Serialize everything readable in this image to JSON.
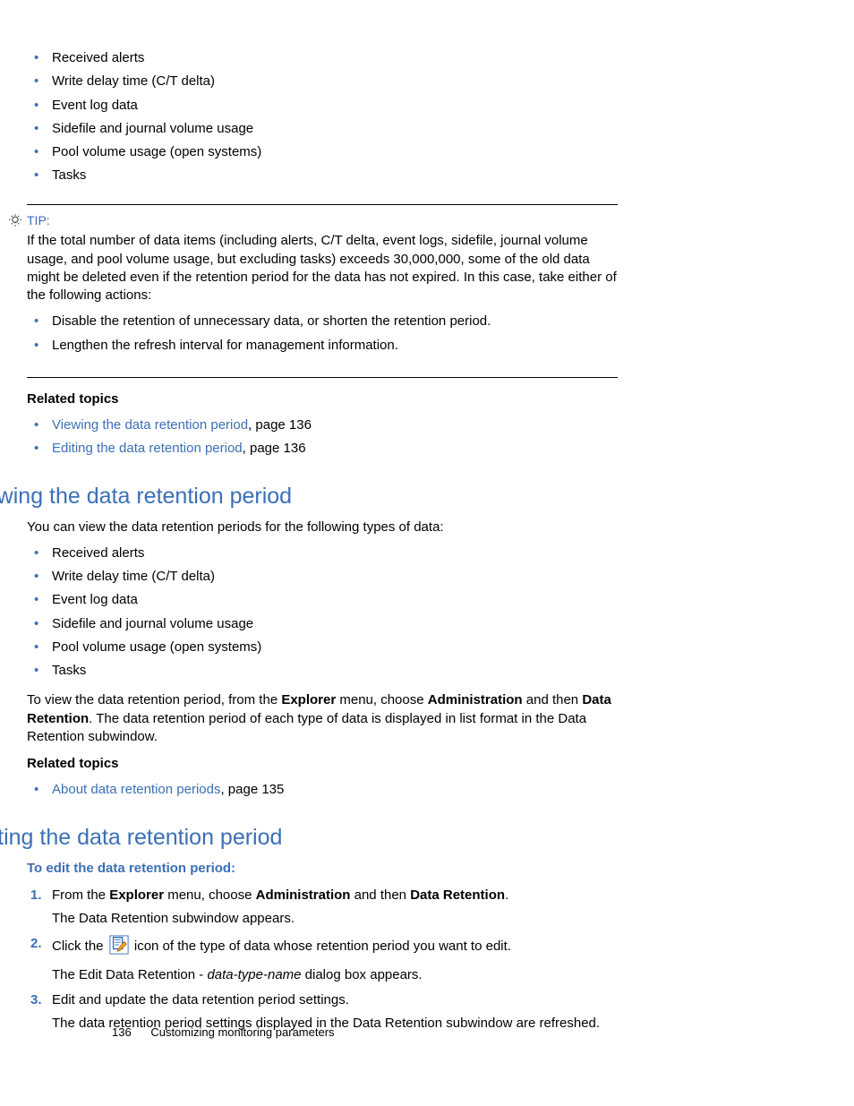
{
  "topList": [
    "Received alerts",
    "Write delay time (C/T delta)",
    "Event log data",
    "Sidefile and journal volume usage",
    "Pool volume usage (open systems)",
    "Tasks"
  ],
  "tip": {
    "label": "TIP:",
    "body": "If the total number of data items (including alerts, C/T delta, event logs, sidefile, journal volume usage, and pool volume usage, but excluding tasks) exceeds 30,000,000, some of the old data might be deleted even if the retention period for the data has not expired. In this case, take either of the following actions:",
    "items": [
      "Disable the retention of unnecessary data, or shorten the retention period.",
      "Lengthen the refresh interval for management information."
    ]
  },
  "related1": {
    "heading": "Related topics",
    "items": [
      {
        "link": "Viewing the data retention period",
        "suffix": ", page 136"
      },
      {
        "link": "Editing the data retention period",
        "suffix": ", page 136"
      }
    ]
  },
  "section1": {
    "title": "Viewing the data retention period",
    "intro": "You can view the data retention periods for the following types of data:",
    "list": [
      "Received alerts",
      "Write delay time (C/T delta)",
      "Event log data",
      "Sidefile and journal volume usage",
      "Pool volume usage (open systems)",
      "Tasks"
    ],
    "para_parts": {
      "t1": "To view the data retention period, from the ",
      "b1": "Explorer",
      "t2": " menu, choose ",
      "b2": "Administration",
      "t3": " and then ",
      "b3": "Data Retention",
      "t4": ". The data retention period of each type of data is displayed in list format in the Data Retention subwindow."
    },
    "related": {
      "heading": "Related topics",
      "items": [
        {
          "link": "About data retention periods",
          "suffix": ", page 135"
        }
      ]
    }
  },
  "section2": {
    "title": "Editing the data retention period",
    "procTitle": "To edit the data retention period:",
    "steps": {
      "s1": {
        "t1": "From the ",
        "b1": "Explorer",
        "t2": " menu, choose ",
        "b2": "Administration",
        "t3": " and then ",
        "b3": "Data Retention",
        "t4": ".",
        "desc": "The Data Retention subwindow appears."
      },
      "s2": {
        "t1": "Click the ",
        "t2": " icon of the type of data whose retention period you want to edit.",
        "desc_t1": "The Edit Data Retention - ",
        "desc_i": "data-type-name",
        "desc_t2": " dialog box appears."
      },
      "s3": {
        "main": "Edit and update the data retention period settings.",
        "desc": "The data retention period settings displayed in the Data Retention subwindow are refreshed."
      }
    }
  },
  "footer": {
    "page": "136",
    "title": "Customizing monitoring parameters"
  }
}
